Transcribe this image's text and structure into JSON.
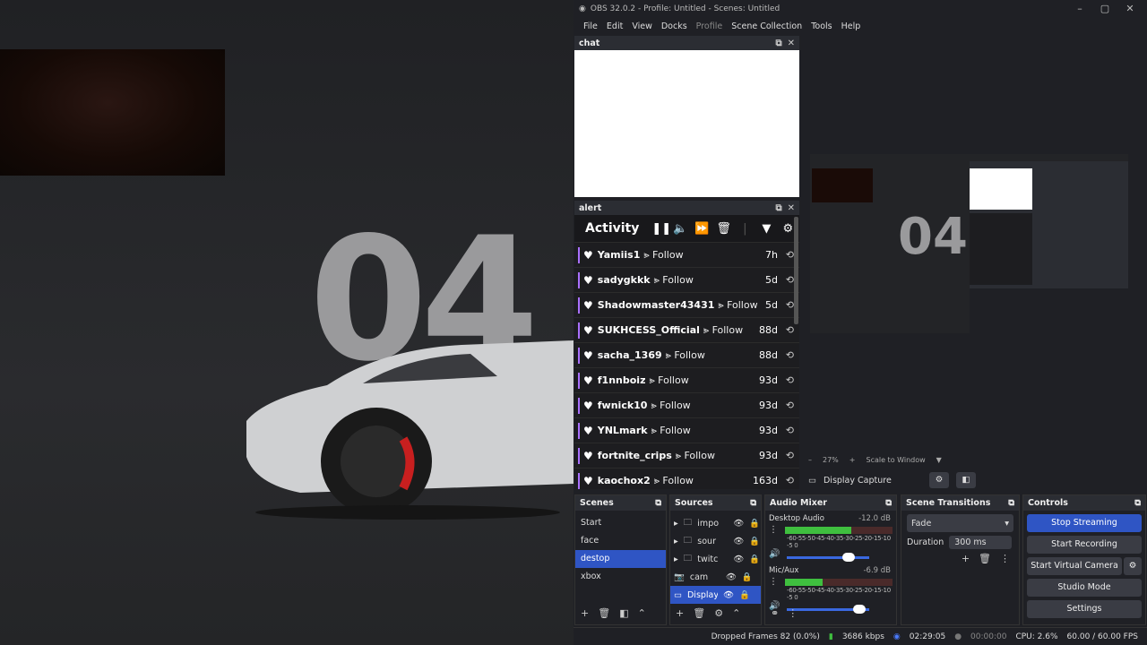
{
  "desktop": {
    "background_number": "04"
  },
  "window": {
    "title": "OBS 32.0.2 - Profile: Untitled - Scenes: Untitled"
  },
  "menu": [
    "File",
    "Edit",
    "View",
    "Docks",
    "Profile",
    "Scene Collection",
    "Tools",
    "Help"
  ],
  "chat": {
    "title": "chat"
  },
  "alert": {
    "title": "alert",
    "activity_label": "Activity",
    "events": [
      {
        "name": "Yamiis1",
        "action": "⪢ Follow",
        "age": "7h"
      },
      {
        "name": "sadygkkk",
        "action": "⪢ Follow",
        "age": "5d"
      },
      {
        "name": "Shadowmaster43431",
        "action": "⪢ Follow",
        "age": "5d"
      },
      {
        "name": "SUKHCESS_Official",
        "action": "⪢ Follow",
        "age": "88d"
      },
      {
        "name": "sacha_1369",
        "action": "⪢ Follow",
        "age": "88d"
      },
      {
        "name": "f1nnboiz",
        "action": "⪢ Follow",
        "age": "93d"
      },
      {
        "name": "fwnick10",
        "action": "⪢ Follow",
        "age": "93d"
      },
      {
        "name": "YNLmark",
        "action": "⪢ Follow",
        "age": "93d"
      },
      {
        "name": "fortnite_crips",
        "action": "⪢ Follow",
        "age": "93d"
      },
      {
        "name": "kaochox2",
        "action": "⪢ Follow",
        "age": "163d"
      }
    ]
  },
  "preview": {
    "zoom": "27%",
    "scale_mode": "Scale to Window",
    "source_label": "Display Capture"
  },
  "scenes": {
    "title": "Scenes",
    "items": [
      "Start",
      "face",
      "destop",
      "xbox"
    ],
    "selected_index": 2
  },
  "sources": {
    "title": "Sources",
    "items": [
      "impo",
      "sour",
      "twitc",
      "cam",
      "Display C"
    ]
  },
  "mixer": {
    "title": "Audio Mixer",
    "channels": [
      {
        "name": "Desktop Audio",
        "db": "-12.0 dB",
        "level": 0.62,
        "volume": 0.75
      },
      {
        "name": "Mic/Aux",
        "db": "-6.9 dB",
        "level": 0.35,
        "volume": 0.88
      }
    ],
    "scale": "-60-55-50-45-40-35-30-25-20-15-10 -5  0"
  },
  "transitions": {
    "title": "Scene Transitions",
    "selected": "Fade",
    "duration_label": "Duration",
    "duration": "300 ms"
  },
  "controls": {
    "title": "Controls",
    "buttons": [
      "Stop Streaming",
      "Start Recording",
      "Start Virtual Camera",
      "Studio Mode",
      "Settings"
    ]
  },
  "status": {
    "dropped": "Dropped Frames 82 (0.0%)",
    "bitrate": "3686 kbps",
    "stream_time": "02:29:05",
    "rec_time": "00:00:00",
    "cpu": "CPU: 2.6%",
    "fps": "60.00 / 60.00 FPS"
  }
}
